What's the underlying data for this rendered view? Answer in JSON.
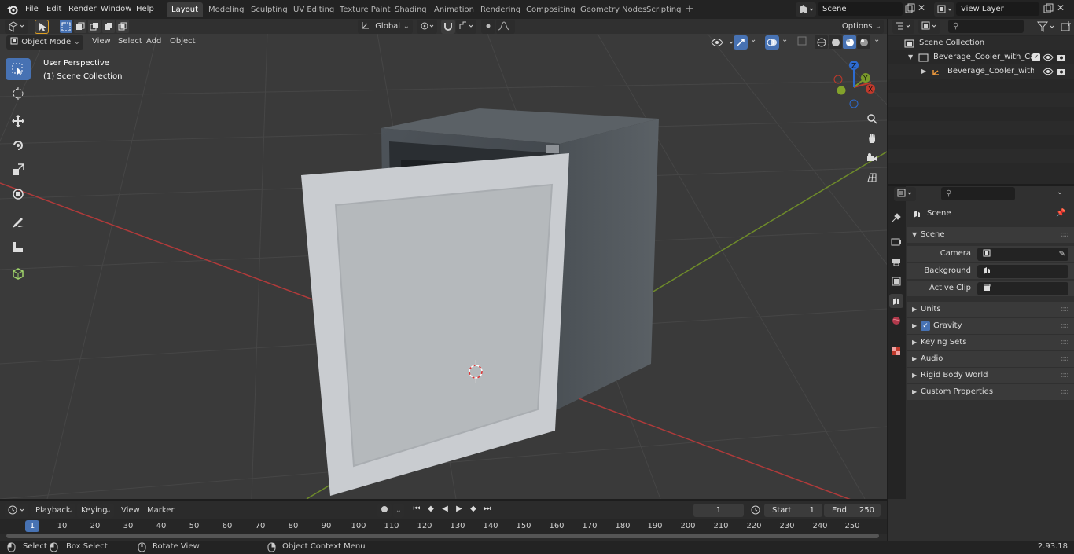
{
  "app": {
    "name": "Blender",
    "version": "2.93.18"
  },
  "menu": [
    "File",
    "Edit",
    "Render",
    "Window",
    "Help"
  ],
  "workspaces": [
    {
      "label": "Layout",
      "active": true
    },
    {
      "label": "Modeling"
    },
    {
      "label": "Sculpting"
    },
    {
      "label": "UV Editing"
    },
    {
      "label": "Texture Paint"
    },
    {
      "label": "Shading"
    },
    {
      "label": "Animation"
    },
    {
      "label": "Rendering"
    },
    {
      "label": "Compositing"
    },
    {
      "label": "Geometry Nodes"
    },
    {
      "label": "Scripting"
    }
  ],
  "scene_selector": {
    "value": "Scene"
  },
  "view_layer_selector": {
    "value": "View Layer"
  },
  "viewport_header": {
    "mode": "Object Mode",
    "menus": [
      "View",
      "Select",
      "Add",
      "Object"
    ],
    "transform_orientation": "Global",
    "options_label": "Options"
  },
  "viewport_overlay_text": {
    "perspective": "User Perspective",
    "collection": "(1) Scene Collection"
  },
  "gizmo_axes": [
    "X",
    "Y",
    "Z"
  ],
  "outliner": {
    "root": "Scene Collection",
    "items": [
      {
        "label": "Beverage_Cooler_with_Cans_",
        "level": 1
      },
      {
        "label": "Beverage_Cooler_with_C",
        "level": 2
      }
    ]
  },
  "properties": {
    "breadcrumb": "Scene",
    "panel_title": "Scene",
    "fields": [
      {
        "label": "Camera",
        "value": ""
      },
      {
        "label": "Background Scene",
        "value": ""
      },
      {
        "label": "Active Clip",
        "value": ""
      }
    ],
    "sections": [
      {
        "label": "Units"
      },
      {
        "label": "Gravity",
        "checkbox": true,
        "checked": true
      },
      {
        "label": "Keying Sets"
      },
      {
        "label": "Audio"
      },
      {
        "label": "Rigid Body World"
      },
      {
        "label": "Custom Properties"
      }
    ]
  },
  "timeline": {
    "menus": [
      "Playback",
      "Keying",
      "View",
      "Marker"
    ],
    "current_frame": "1",
    "start_label": "Start",
    "start_value": "1",
    "end_label": "End",
    "end_value": "250",
    "ticks": [
      "1",
      "10",
      "20",
      "30",
      "40",
      "50",
      "60",
      "70",
      "80",
      "90",
      "100",
      "110",
      "120",
      "130",
      "140",
      "150",
      "160",
      "170",
      "180",
      "190",
      "200",
      "210",
      "220",
      "230",
      "240",
      "250"
    ]
  },
  "statusbar": {
    "items": [
      "Select",
      "Box Select",
      "Rotate View",
      "Object Context Menu"
    ],
    "version": "2.93.18"
  },
  "colors": {
    "accent": "#4772b3",
    "x_axis": "#c0392b",
    "y_axis": "#7a9a2a",
    "viewport_bg": "#3a3a3a"
  }
}
